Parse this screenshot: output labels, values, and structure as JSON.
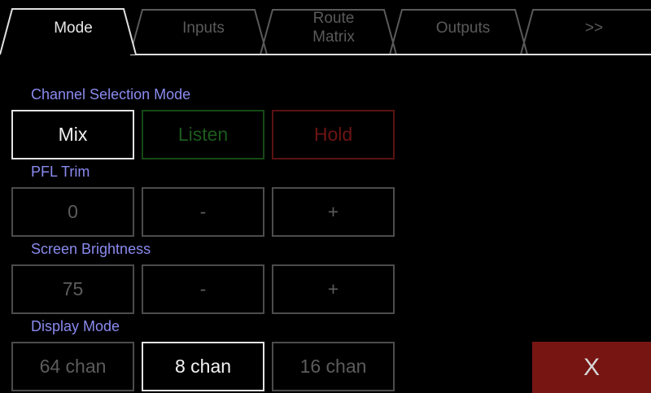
{
  "tabs": [
    {
      "label": "Mode",
      "active": true
    },
    {
      "label": "Inputs",
      "active": false
    },
    {
      "label": "Route\nMatrix",
      "active": false
    },
    {
      "label": "Outputs",
      "active": false
    },
    {
      "label": ">>",
      "active": false
    }
  ],
  "channel_selection": {
    "label": "Channel Selection Mode",
    "mix": "Mix",
    "listen": "Listen",
    "hold": "Hold",
    "selected": "Mix"
  },
  "pfl_trim": {
    "label": "PFL Trim",
    "value": "0",
    "decrement": "-",
    "increment": "+"
  },
  "screen_brightness": {
    "label": "Screen Brightness",
    "value": "75",
    "decrement": "-",
    "increment": "+"
  },
  "display_mode": {
    "label": "Display Mode",
    "options": [
      "64 chan",
      "8 chan",
      "16 chan"
    ],
    "selected": "8 chan"
  },
  "close_label": "X",
  "colors": {
    "section_label": "#8a8af0",
    "listen": "#1d5a1d",
    "hold": "#6e1414",
    "close_bg": "#771513"
  }
}
